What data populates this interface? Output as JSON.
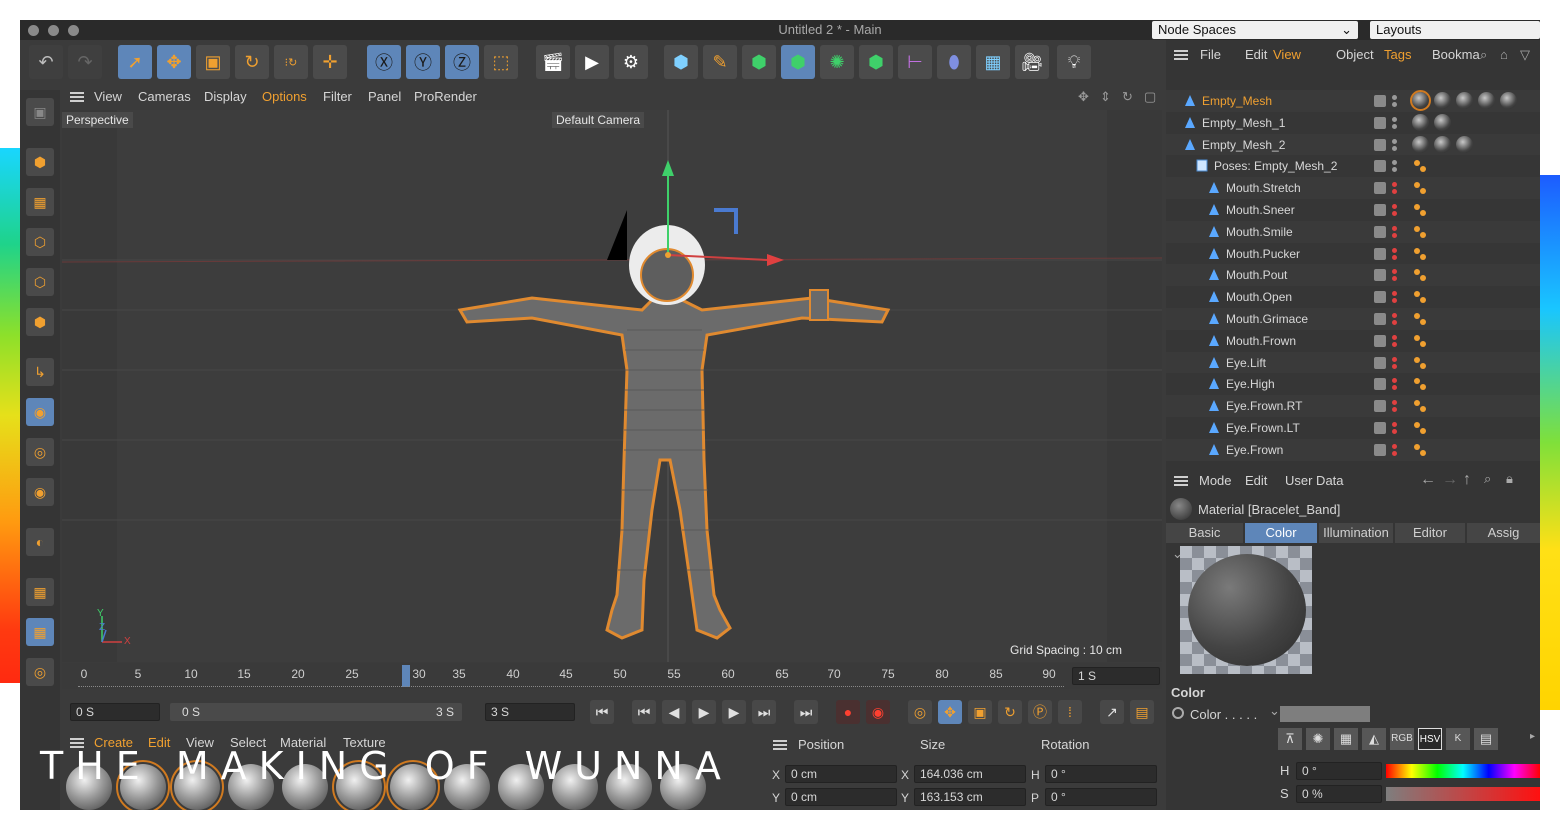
{
  "window": {
    "title": "Untitled 2 * - Main",
    "node_spaces": "Node Spaces",
    "layouts": "Layouts"
  },
  "viewport_menu": [
    "View",
    "Cameras",
    "Display",
    "Options",
    "Filter",
    "Panel",
    "ProRender"
  ],
  "viewport": {
    "view_name": "Perspective",
    "camera": "Default Camera",
    "grid_spacing": "Grid Spacing : 10 cm",
    "axis_y": "Y",
    "axis_z": "Z",
    "axis_x": "X"
  },
  "timeline": {
    "ticks": [
      "0",
      "5",
      "10",
      "15",
      "20",
      "25",
      "30",
      "35",
      "40",
      "45",
      "50",
      "55",
      "60",
      "65",
      "70",
      "75",
      "80",
      "85",
      "90"
    ],
    "end_field": "1 S",
    "start": "0 S",
    "range_start": "0 S",
    "range_end": "3 S",
    "max": "3 S"
  },
  "material_menu": [
    "Create",
    "Edit",
    "View",
    "Select",
    "Material",
    "Texture"
  ],
  "coords": {
    "headers": [
      "Position",
      "Size",
      "Rotation"
    ],
    "rows": [
      {
        "axis": "X",
        "pos": "0 cm",
        "size_axis": "X",
        "size": "164.036 cm",
        "rot_axis": "H",
        "rot": "0 °"
      },
      {
        "axis": "Y",
        "pos": "0 cm",
        "size_axis": "Y",
        "size": "163.153 cm",
        "rot_axis": "P",
        "rot": "0 °"
      }
    ]
  },
  "object_menu": [
    "File",
    "Edit",
    "View",
    "Object",
    "Tags",
    "Bookma"
  ],
  "objects": [
    {
      "name": "Empty_Mesh",
      "level": 0,
      "highlight": true
    },
    {
      "name": "Empty_Mesh_1",
      "level": 0
    },
    {
      "name": "Empty_Mesh_2",
      "level": 0
    },
    {
      "name": "Poses: Empty_Mesh_2",
      "level": 1
    },
    {
      "name": "Mouth.Stretch",
      "level": 2
    },
    {
      "name": "Mouth.Sneer",
      "level": 2
    },
    {
      "name": "Mouth.Smile",
      "level": 2
    },
    {
      "name": "Mouth.Pucker",
      "level": 2
    },
    {
      "name": "Mouth.Pout",
      "level": 2
    },
    {
      "name": "Mouth.Open",
      "level": 2
    },
    {
      "name": "Mouth.Grimace",
      "level": 2
    },
    {
      "name": "Mouth.Frown",
      "level": 2
    },
    {
      "name": "Eye.Lift",
      "level": 2
    },
    {
      "name": "Eye.High",
      "level": 2
    },
    {
      "name": "Eye.Frown.RT",
      "level": 2
    },
    {
      "name": "Eye.Frown.LT",
      "level": 2
    },
    {
      "name": "Eye.Frown",
      "level": 2
    }
  ],
  "attributes": {
    "menu": [
      "Mode",
      "Edit",
      "User Data"
    ],
    "material": "Material [Bracelet_Band]",
    "tabs": [
      "Basic",
      "Color",
      "Illumination",
      "Editor",
      "Assig"
    ],
    "section": "Color",
    "color_label": "Color . . . . .",
    "modes": [
      "RGB",
      "HSV",
      "K"
    ],
    "h_label": "H",
    "h_value": "0 °",
    "s_label": "S",
    "s_value": "0 %"
  },
  "watermark": "THE MAKING OF WUNNA",
  "colors": {
    "accent": "#f0a030",
    "selection": "#5e86b9",
    "highlight_text": "#f0a030"
  }
}
